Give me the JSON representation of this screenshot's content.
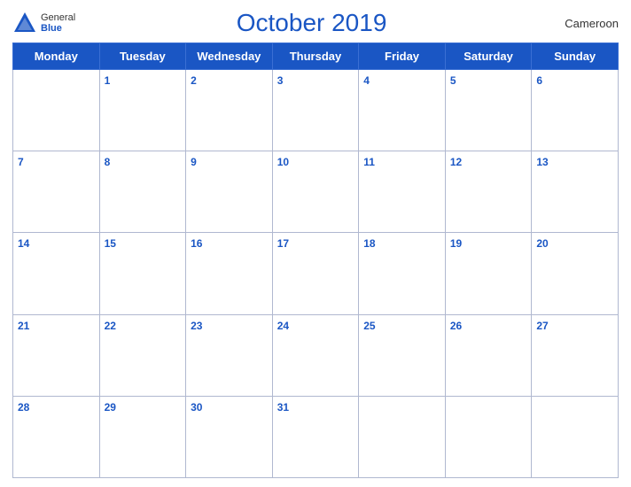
{
  "header": {
    "logo_general": "General",
    "logo_blue": "Blue",
    "title": "October 2019",
    "country": "Cameroon"
  },
  "weekdays": [
    "Monday",
    "Tuesday",
    "Wednesday",
    "Thursday",
    "Friday",
    "Saturday",
    "Sunday"
  ],
  "weeks": [
    [
      null,
      1,
      2,
      3,
      4,
      5,
      6
    ],
    [
      7,
      8,
      9,
      10,
      11,
      12,
      13
    ],
    [
      14,
      15,
      16,
      17,
      18,
      19,
      20
    ],
    [
      21,
      22,
      23,
      24,
      25,
      26,
      27
    ],
    [
      28,
      29,
      30,
      31,
      null,
      null,
      null
    ]
  ]
}
